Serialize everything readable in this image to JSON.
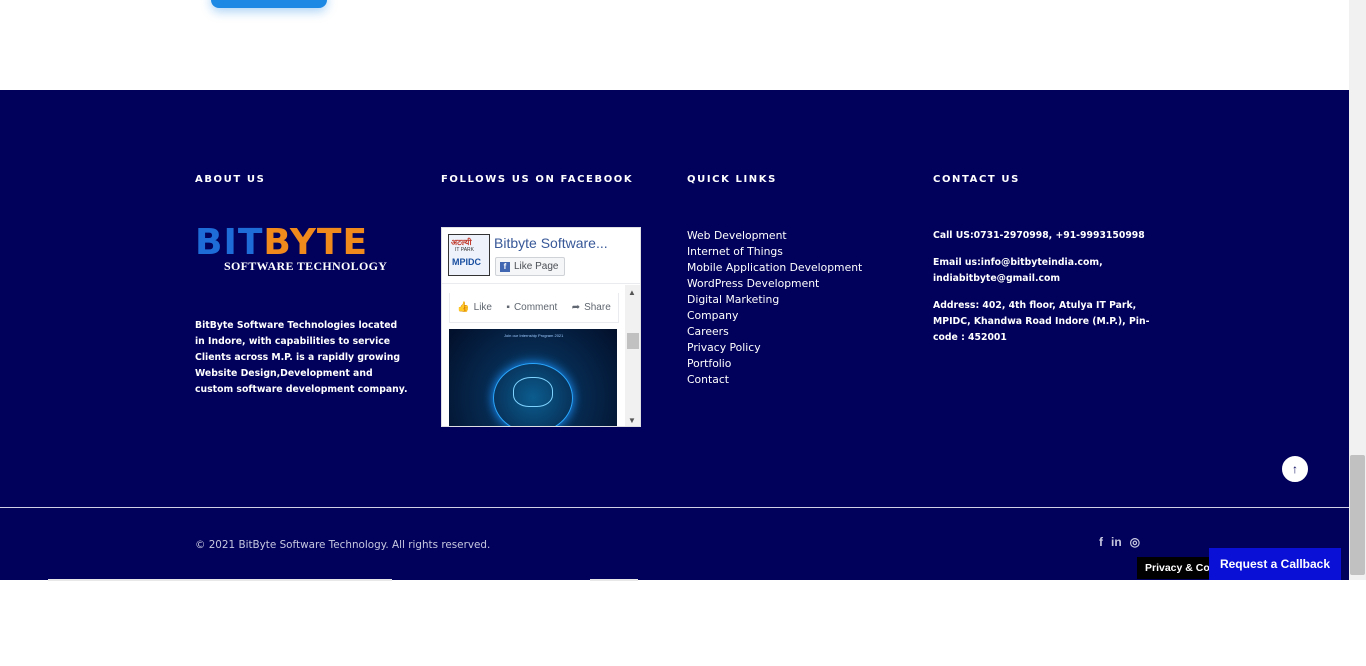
{
  "footer": {
    "about": {
      "heading": "ABOUT US",
      "logo_word_blue": "BIT",
      "logo_word_orange": "BYTE",
      "logo_sub": "SOFTWARE TECHNOLOGY",
      "text": "BitByte Software Technologies located in Indore, with capabilities to service Clients across M.P. is a rapidly growing Website Design,Development and custom software development company."
    },
    "facebook": {
      "heading": "FOLLOWS US ON FACEBOOK",
      "thumb_line1": "अटल्यी",
      "thumb_line2": "IT PARK",
      "thumb_line3": "MPIDC",
      "page_name": "Bitbyte Software...",
      "like_page_label": "Like Page",
      "actions": [
        "Like",
        "Comment",
        "Share"
      ],
      "post_caption": "Join our Internship Program 2021"
    },
    "quick_links": {
      "heading": "QUICK LINKS",
      "items": [
        "Web Development",
        "Internet of Things",
        "Mobile Application Development",
        "WordPress Development",
        "Digital Marketing",
        "Company",
        "Careers",
        "Privacy Policy",
        "Portfolio",
        "Contact"
      ]
    },
    "contact": {
      "heading": "CONTACT US",
      "phone": "Call US:0731-2970998, +91-9993150998",
      "email": "Email us:info@bitbyteindia.com, indiabitbyte@gmail.com",
      "address": "Address: 402, 4th floor, Atulya IT Park, MPIDC, Khandwa Road Indore (M.P.), Pin-code : 452001"
    },
    "copyright": "© 2021 BitByte Software Technology. All rights reserved.",
    "social_icons": [
      "facebook-icon",
      "linkedin-icon",
      "instagram-icon"
    ],
    "social_glyphs": [
      "f",
      "in",
      "◎"
    ],
    "to_top_glyph": "↑"
  },
  "widgets": {
    "privacy_label": "Privacy & Cookies Policy",
    "callback_label": "Request a Callback"
  },
  "colors": {
    "footer_bg": "#01005a",
    "callback_bg": "#0a10d6",
    "logo_blue": "#1e6cd8",
    "logo_orange": "#f18a1d"
  }
}
